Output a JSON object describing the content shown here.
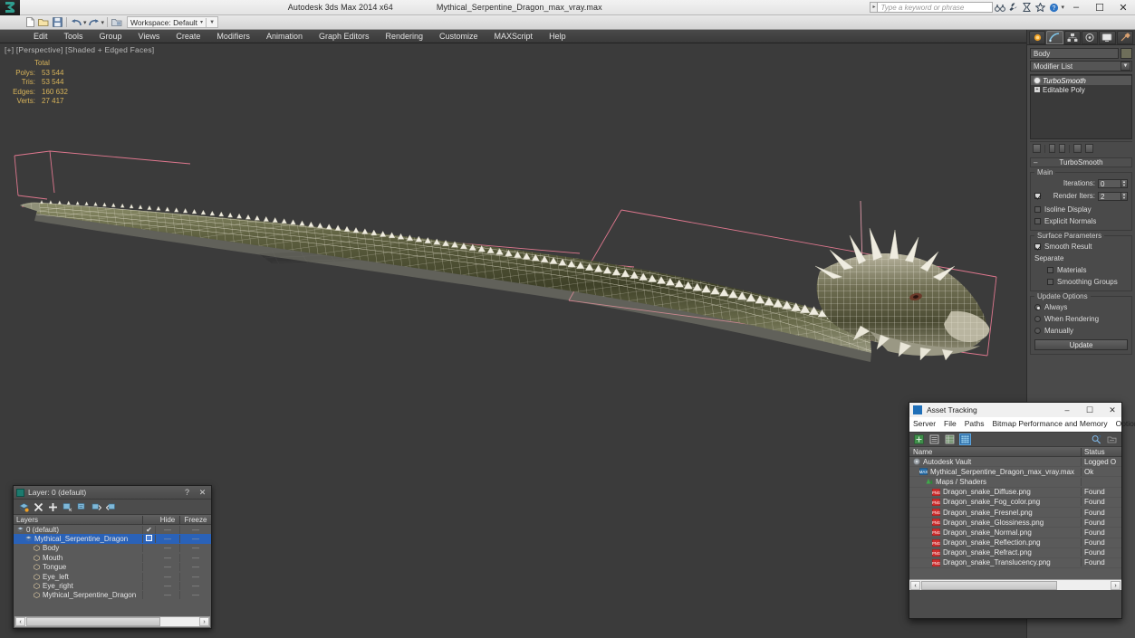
{
  "titlebar": {
    "app_title": "Autodesk 3ds Max  2014 x64",
    "file_title": "Mythical_Serpentine_Dragon_max_vray.max",
    "search_placeholder": "Type a keyword or phrase",
    "minimize": "–",
    "maximize": "☐",
    "close": "✕"
  },
  "toolbar": {
    "workspace_label": "Workspace: Default",
    "caret": "▾",
    "dropdown": "▼"
  },
  "menu": {
    "items": [
      "Edit",
      "Tools",
      "Group",
      "Views",
      "Create",
      "Modifiers",
      "Animation",
      "Graph Editors",
      "Rendering",
      "Customize",
      "MAXScript",
      "Help"
    ]
  },
  "viewport": {
    "label": "[+] [Perspective] [Shaded + Edged Faces]",
    "stats": {
      "header": "Total",
      "rows": [
        {
          "label": "Polys:",
          "value": "53 544"
        },
        {
          "label": "Tris:",
          "value": "53 544"
        },
        {
          "label": "Edges:",
          "value": "160 632"
        },
        {
          "label": "Verts:",
          "value": "27 417"
        }
      ]
    }
  },
  "command_panel": {
    "tabs": [
      "create-tab",
      "modify-tab",
      "hierarchy-tab",
      "motion-tab",
      "display-tab",
      "utilities-tab"
    ],
    "active_tab": "modify-tab",
    "object_name": "Body",
    "object_color": "#6e6e5a",
    "modifier_list_label": "Modifier List",
    "stack": [
      {
        "name": "TurboSmooth",
        "selected": true
      },
      {
        "name": "Editable Poly",
        "selected": false
      }
    ],
    "turbosmooth": {
      "rollout_title": "TurboSmooth",
      "collapse_glyph": "–",
      "main_group": "Main",
      "iterations_label": "Iterations:",
      "iterations_value": "0",
      "render_iters_label": "Render Iters:",
      "render_iters_value": "2",
      "render_iters_checked": true,
      "isoline_display_label": "Isoline Display",
      "isoline_display_checked": false,
      "explicit_normals_label": "Explicit Normals",
      "explicit_normals_checked": false,
      "surface_group": "Surface Parameters",
      "smooth_result_label": "Smooth Result",
      "smooth_result_checked": true,
      "separate_label": "Separate",
      "materials_label": "Materials",
      "materials_checked": false,
      "smoothing_groups_label": "Smoothing Groups",
      "smoothing_groups_checked": false,
      "update_group": "Update Options",
      "update_always": "Always",
      "update_when_rendering": "When Rendering",
      "update_manually": "Manually",
      "update_selected": "Always",
      "update_button": "Update"
    }
  },
  "layer_dialog": {
    "title": "Layer: 0 (default)",
    "help_btn": "?",
    "close_btn": "✕",
    "columns": {
      "name": "Layers",
      "hide": "Hide",
      "freeze": "Freeze"
    },
    "rows": [
      {
        "name": "0 (default)",
        "indent": 0,
        "icon": "layer-icon",
        "selected": false,
        "current": "✔",
        "hide": "—",
        "freeze": "—"
      },
      {
        "name": "Mythical_Serpentine_Dragon",
        "indent": 1,
        "icon": "layer-icon",
        "selected": true,
        "current": "",
        "hide": "—",
        "freeze": "—"
      },
      {
        "name": "Body",
        "indent": 2,
        "icon": "object-icon",
        "selected": false,
        "current": "",
        "hide": "—",
        "freeze": "—"
      },
      {
        "name": "Mouth",
        "indent": 2,
        "icon": "object-icon",
        "selected": false,
        "current": "",
        "hide": "—",
        "freeze": "—"
      },
      {
        "name": "Tongue",
        "indent": 2,
        "icon": "object-icon",
        "selected": false,
        "current": "",
        "hide": "—",
        "freeze": "—"
      },
      {
        "name": "Eye_left",
        "indent": 2,
        "icon": "object-icon",
        "selected": false,
        "current": "",
        "hide": "—",
        "freeze": "—"
      },
      {
        "name": "Eye_right",
        "indent": 2,
        "icon": "object-icon",
        "selected": false,
        "current": "",
        "hide": "—",
        "freeze": "—"
      },
      {
        "name": "Mythical_Serpentine_Dragon",
        "indent": 2,
        "icon": "object-icon",
        "selected": false,
        "current": "",
        "hide": "—",
        "freeze": "—"
      }
    ],
    "scroll_left": "‹",
    "scroll_right": "›"
  },
  "asset_tracking": {
    "title": "Asset Tracking",
    "minimize": "–",
    "maximize": "☐",
    "close": "✕",
    "menus": [
      "Server",
      "File",
      "Paths",
      "Bitmap Performance and Memory",
      "Options"
    ],
    "columns": {
      "name": "Name",
      "status": "Status"
    },
    "rows": [
      {
        "name": "Autodesk Vault",
        "status": "Logged O",
        "indent": 0,
        "icon": "vault-icon"
      },
      {
        "name": "Mythical_Serpentine_Dragon_max_vray.max",
        "status": "Ok",
        "indent": 1,
        "icon": "max-file-icon"
      },
      {
        "name": "Maps / Shaders",
        "status": "",
        "indent": 2,
        "icon": "maps-icon"
      },
      {
        "name": "Dragon_snake_Diffuse.png",
        "status": "Found",
        "indent": 3,
        "icon": "png-icon"
      },
      {
        "name": "Dragon_snake_Fog_color.png",
        "status": "Found",
        "indent": 3,
        "icon": "png-icon"
      },
      {
        "name": "Dragon_snake_Fresnel.png",
        "status": "Found",
        "indent": 3,
        "icon": "png-icon"
      },
      {
        "name": "Dragon_snake_Glossiness.png",
        "status": "Found",
        "indent": 3,
        "icon": "png-icon"
      },
      {
        "name": "Dragon_snake_Normal.png",
        "status": "Found",
        "indent": 3,
        "icon": "png-icon"
      },
      {
        "name": "Dragon_snake_Reflection.png",
        "status": "Found",
        "indent": 3,
        "icon": "png-icon"
      },
      {
        "name": "Dragon_snake_Refract.png",
        "status": "Found",
        "indent": 3,
        "icon": "png-icon"
      },
      {
        "name": "Dragon_snake_Translucency.png",
        "status": "Found",
        "indent": 3,
        "icon": "png-icon"
      }
    ],
    "scroll_left": "‹",
    "scroll_right": "›"
  },
  "colors": {
    "viewport_bg": "#3b3b3b",
    "stats_text": "#d8b45a",
    "selection_blue": "#2a62b8",
    "mesh_body": "#4b4e32",
    "wireframe": "#e8e4d8",
    "gizmo_pink": "#e87b93"
  }
}
